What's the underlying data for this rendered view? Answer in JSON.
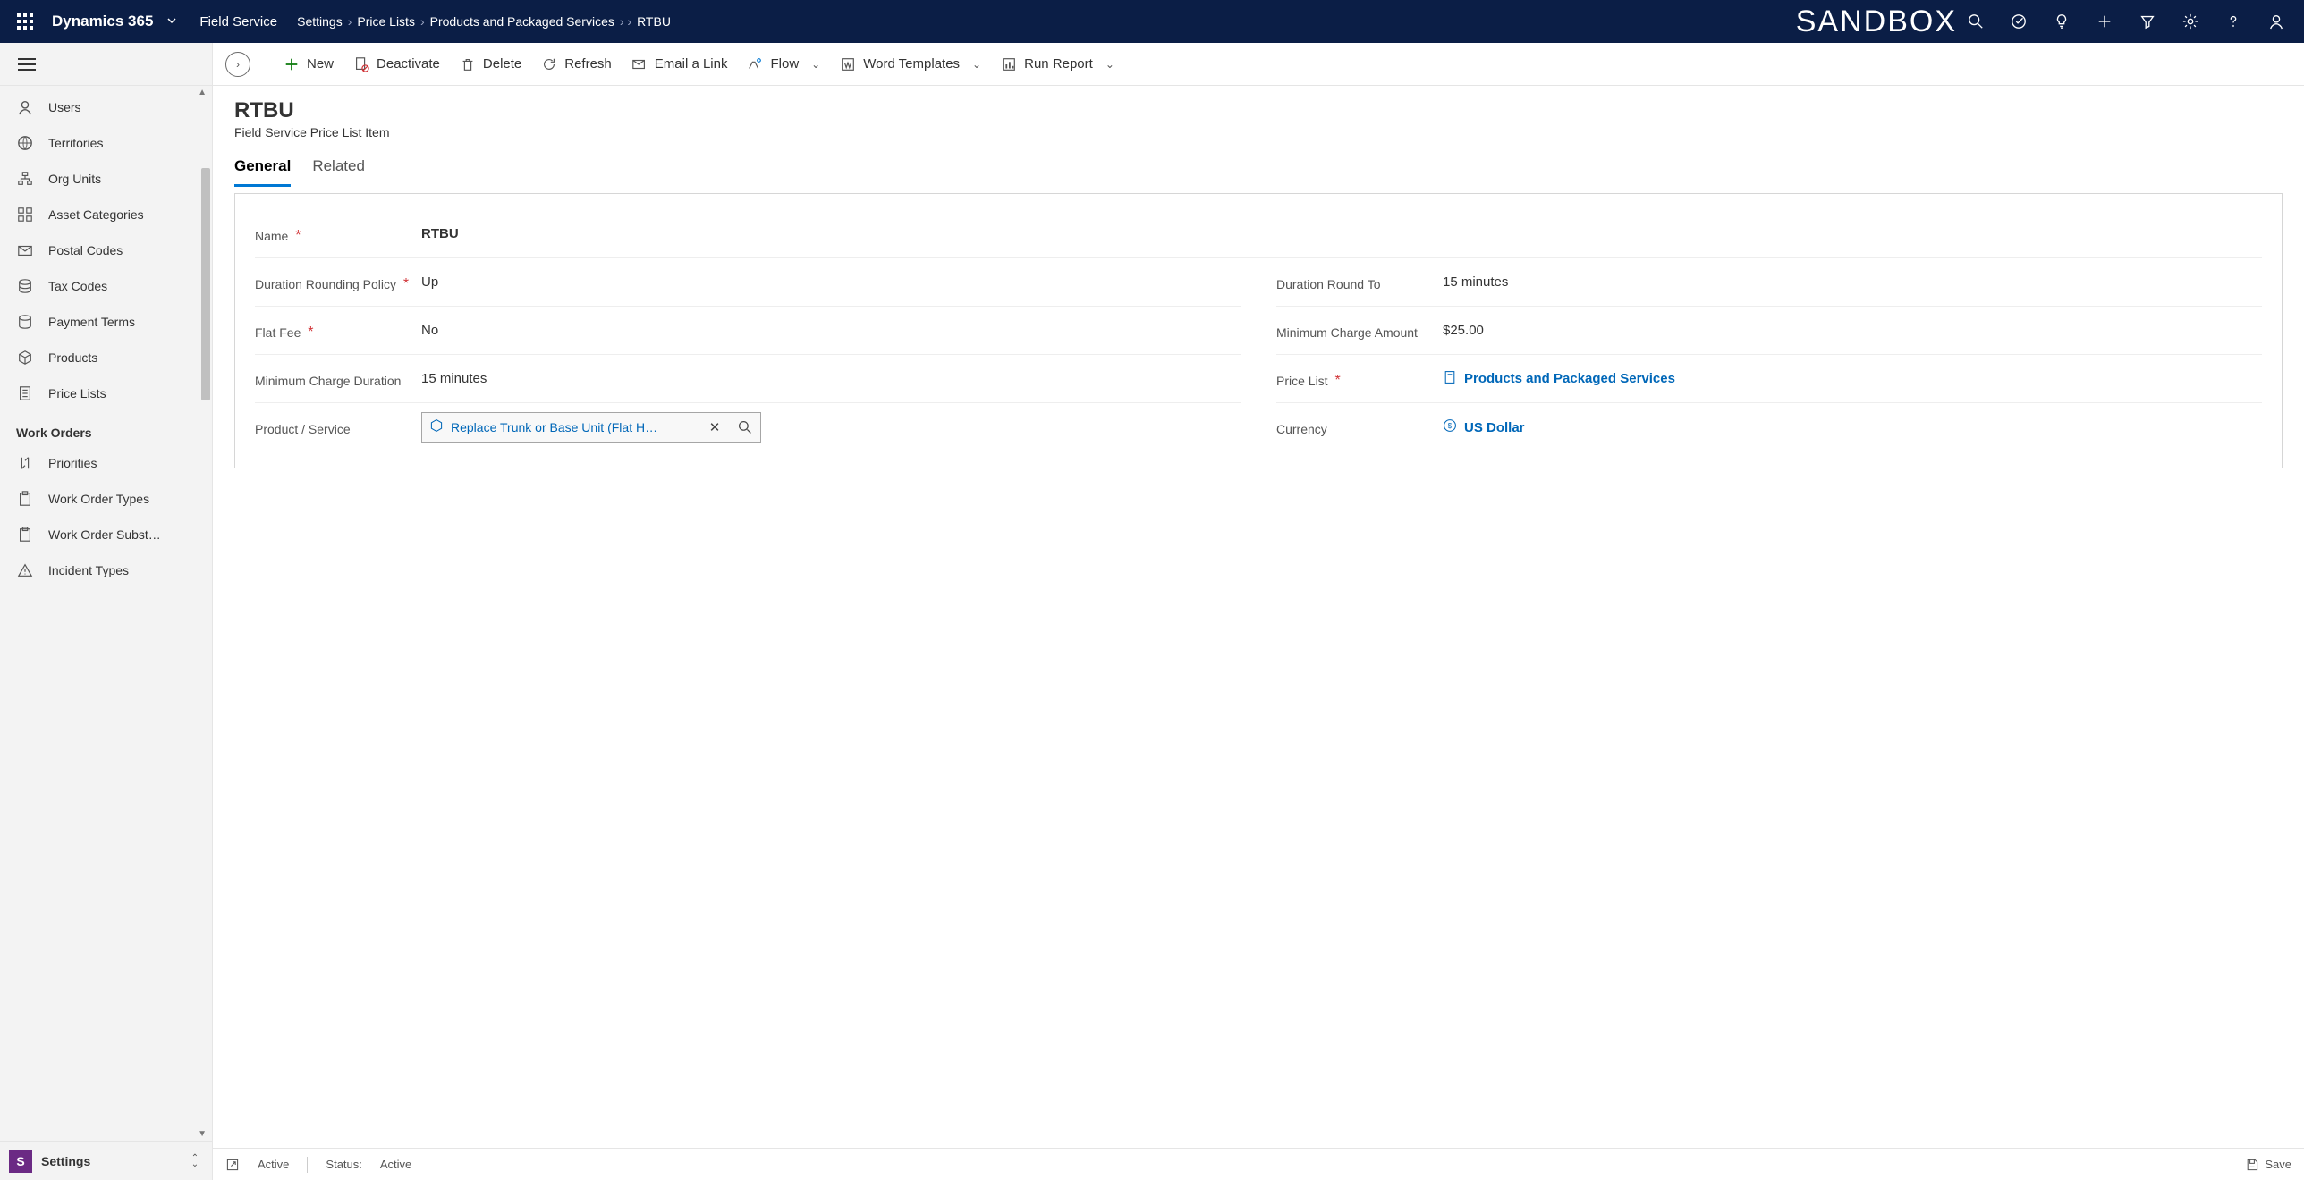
{
  "topbar": {
    "brand": "Dynamics 365",
    "module": "Field Service",
    "sandbox": "SANDBOX",
    "breadcrumbs": [
      "Settings",
      "Price Lists",
      "Products and Packaged Services",
      "RTBU"
    ]
  },
  "commands": {
    "new": "New",
    "deactivate": "Deactivate",
    "delete": "Delete",
    "refresh": "Refresh",
    "email": "Email a Link",
    "flow": "Flow",
    "word": "Word Templates",
    "report": "Run Report"
  },
  "sidebar": {
    "items1": [
      {
        "label": "Users"
      },
      {
        "label": "Territories"
      },
      {
        "label": "Org Units"
      },
      {
        "label": "Asset Categories"
      },
      {
        "label": "Postal Codes"
      },
      {
        "label": "Tax Codes"
      },
      {
        "label": "Payment Terms"
      },
      {
        "label": "Products"
      },
      {
        "label": "Price Lists"
      }
    ],
    "group": "Work Orders",
    "items2": [
      {
        "label": "Priorities"
      },
      {
        "label": "Work Order Types"
      },
      {
        "label": "Work Order Subst…"
      },
      {
        "label": "Incident Types"
      }
    ],
    "areaBadge": "S",
    "area": "Settings"
  },
  "record": {
    "title": "RTBU",
    "subtitle": "Field Service Price List Item",
    "tabs": {
      "general": "General",
      "related": "Related"
    }
  },
  "form": {
    "name": {
      "label": "Name",
      "value": "RTBU"
    },
    "drp": {
      "label": "Duration Rounding Policy",
      "value": "Up"
    },
    "drt": {
      "label": "Duration Round To",
      "value": "15 minutes"
    },
    "flat": {
      "label": "Flat Fee",
      "value": "No"
    },
    "minAmt": {
      "label": "Minimum Charge Amount",
      "value": "$25.00"
    },
    "minDur": {
      "label": "Minimum Charge Duration",
      "value": "15 minutes"
    },
    "priceList": {
      "label": "Price List",
      "value": "Products and Packaged Services"
    },
    "product": {
      "label": "Product / Service",
      "value": "Replace Trunk or Base Unit (Flat H…"
    },
    "currency": {
      "label": "Currency",
      "value": "US Dollar"
    }
  },
  "status": {
    "state": "Active",
    "statusLabel": "Status:",
    "statusValue": "Active",
    "save": "Save"
  }
}
